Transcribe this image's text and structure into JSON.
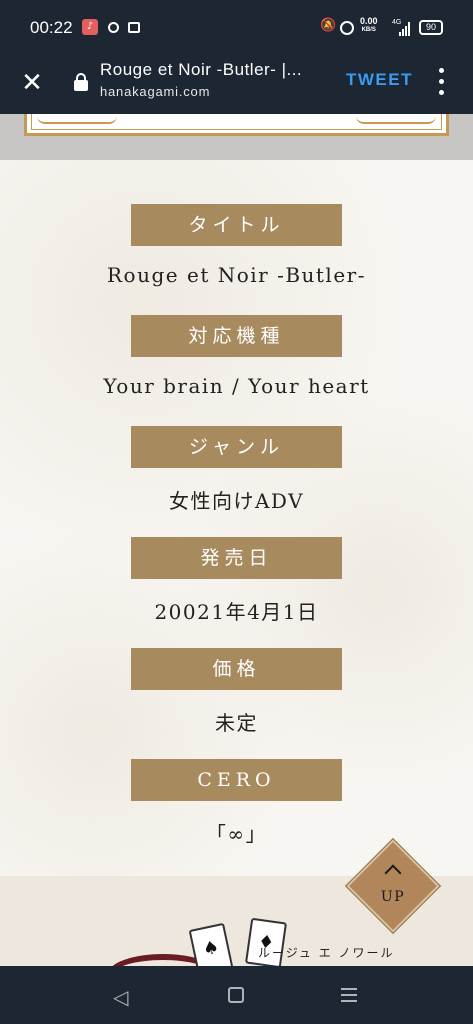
{
  "status_bar": {
    "time": "00:22",
    "app_badge": "♪",
    "speed_value": "0.00",
    "speed_unit": "KB/S",
    "network": "4G",
    "battery": "90"
  },
  "browser": {
    "page_title": "Rouge et Noir -Butler- |...",
    "domain": "hanakagami.com",
    "tweet_label": "TWEET"
  },
  "info": [
    {
      "label": "タイトル",
      "value": "Rouge et Noir -Butler-"
    },
    {
      "label": "対応機種",
      "value": "Your brain / Your heart"
    },
    {
      "label": "ジャンル",
      "value": "女性向けADV"
    },
    {
      "label": "発売日",
      "value": "20021年4月1日"
    },
    {
      "label": "価格",
      "value": "未定"
    },
    {
      "label": "CERO",
      "value": "「∞」"
    }
  ],
  "footer": {
    "up_label": "UP",
    "logo_kana": "ルージュ エ ノワール"
  },
  "icons": {
    "close": "close-icon",
    "lock": "lock-icon",
    "menu": "more-vert-icon",
    "up": "chevron-up-icon",
    "back": "back-triangle-icon",
    "home": "home-square-icon",
    "recent": "recents-icon"
  },
  "colors": {
    "label_bg": "#a88a5f",
    "bar_bg": "#1d2633",
    "tweet": "#3b9bf0",
    "up_button": "#b0865a"
  }
}
